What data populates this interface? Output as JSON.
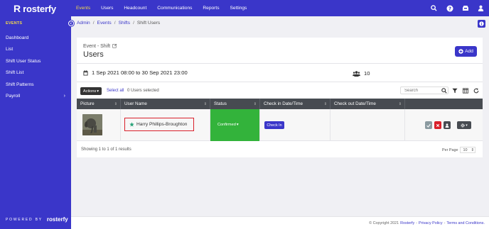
{
  "brand": {
    "name": "rosterfy",
    "mark": "R"
  },
  "topnav": {
    "items": [
      {
        "label": "Events",
        "active": true
      },
      {
        "label": "Users",
        "active": false
      },
      {
        "label": "Headcount",
        "active": false
      },
      {
        "label": "Communications",
        "active": false
      },
      {
        "label": "Reports",
        "active": false
      },
      {
        "label": "Settings",
        "active": false
      }
    ],
    "icons": [
      "search-icon",
      "help-icon",
      "inbox-icon",
      "user-icon"
    ]
  },
  "sidebar": {
    "section": "EVENTS",
    "items": [
      {
        "label": "Dashboard"
      },
      {
        "label": "List"
      },
      {
        "label": "Shift User Status"
      },
      {
        "label": "Shift List"
      },
      {
        "label": "Shift Patterns"
      },
      {
        "label": "Payroll",
        "has_children": true
      }
    ],
    "powered_by": "POWERED BY",
    "powered_logo": "rosterfy"
  },
  "breadcrumb": [
    "Admin",
    "Events",
    "Shifts",
    "Shift Users"
  ],
  "page": {
    "eyebrow": "Event - Shift",
    "title": "Users",
    "add_label": "Add",
    "date_range": "1 Sep 2021 08:00 to 30 Sep 2021 23:00",
    "user_count": "10"
  },
  "toolbar": {
    "actions_label": "Actions",
    "select_all": "Select all",
    "users_selected": "0 Users selected",
    "search_placeholder": "Search"
  },
  "table": {
    "columns": [
      "Picture",
      "User Name",
      "Status",
      "Check in Date/Time",
      "Check out Date/Time"
    ],
    "rows": [
      {
        "user_name": "Harry Phillips-Broughton",
        "status": "Confirmed",
        "status_color": "#33b33b",
        "check_in_label": "Check In"
      }
    ]
  },
  "pagination": {
    "showing": "Showing 1 to 1 of 1 results",
    "per_page_label": "Per Page",
    "per_page_value": "10"
  },
  "footer": {
    "copyright": "© Copyright 2021",
    "brand_link": "Rosterfy",
    "privacy": "Privacy Policy",
    "terms": "Terms and Conditions."
  },
  "colors": {
    "primary": "#3a36c9",
    "accent": "#f2d84a",
    "success": "#33b33b",
    "danger": "#d9202b",
    "table_header": "#474b51"
  }
}
